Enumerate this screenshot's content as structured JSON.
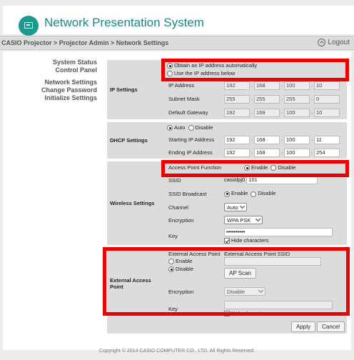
{
  "app": {
    "title": "Network Presentation System",
    "logo_icon": "projector-icon",
    "brand_color": "#1a9a8e"
  },
  "breadcrumb": "CASIO Projector > Projector Admin > Network Settings",
  "logout": {
    "label": "Logout",
    "icon": "arrow-up-circle-icon"
  },
  "nav": [
    {
      "label": "System Status"
    },
    {
      "label": "Control Panel"
    },
    {
      "label": "Network Settings"
    },
    {
      "label": "Change Password"
    },
    {
      "label": "Initialize Settings"
    }
  ],
  "ip": {
    "section": "IP Settings",
    "auto_label": "Obtain an IP address automatically",
    "manual_label": "Use the IP address below",
    "selected": "auto",
    "address_label": "IP Address",
    "address": [
      "192",
      "168",
      "100",
      "10"
    ],
    "mask_label": "Subnet Mask",
    "mask": [
      "255",
      "255",
      "255",
      "0"
    ],
    "gateway_label": "Default Gateway",
    "gateway": [
      "192",
      "168",
      "100",
      "10"
    ]
  },
  "dhcp": {
    "section": "DHCP Settings",
    "auto_label": "Auto",
    "disable_label": "Disable",
    "selected": "auto",
    "start_label": "Starting IP Address",
    "start": [
      "192",
      "168",
      "100",
      "11"
    ],
    "end_label": "Ending IP Address",
    "end": [
      "192",
      "168",
      "100",
      "254"
    ]
  },
  "wireless": {
    "section": "Wireless Settings",
    "ap_label": "Access Point Function",
    "enable_label": "Enable",
    "disable_label": "Disable",
    "ap_selected": "enable",
    "ssid_label": "SSID",
    "ssid_prefix": "casiolpj0",
    "ssid_value": "101",
    "broadcast_label": "SSID Broadcast",
    "broadcast_selected": "enable",
    "channel_label": "Channel",
    "channel_value": "Auto",
    "enc_label": "Encryption",
    "enc_value": "WPA PSK",
    "key_label": "Key",
    "key_value": "••••••••••",
    "hide_label": "Hide characters",
    "hide_checked": true
  },
  "external": {
    "section": "External Access Point",
    "ap_label": "External Access Point",
    "enable_label": "Enable",
    "disable_label": "Disable",
    "selected": "disable",
    "ssid_label": "External Access Point SSID",
    "scan_label": "AP Scan",
    "enc_label": "Encryption",
    "enc_value": "Disable",
    "key_label": "Key",
    "hide_label": "Hide characters",
    "hide_checked": true
  },
  "actions": {
    "apply": "Apply",
    "cancel": "Cancel"
  },
  "footer": "Copyright © 2014 CASIO COMPUTER CO., LTD. All Rights Reserved.",
  "highlight_color": "#ee0000"
}
